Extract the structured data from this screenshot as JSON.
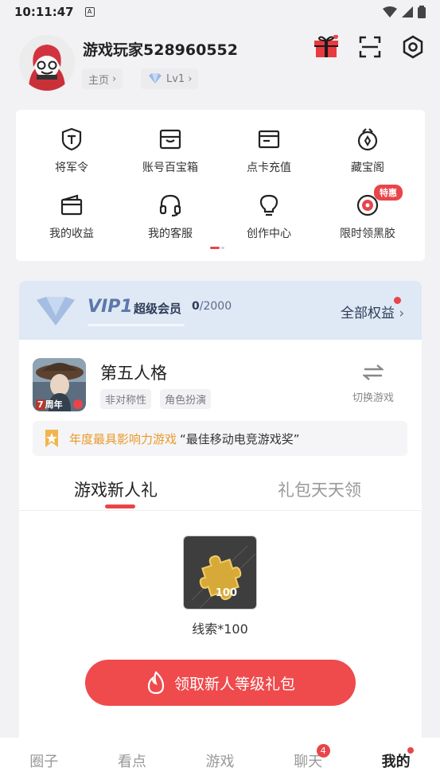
{
  "status": {
    "time": "10:11:47",
    "indicator": "A"
  },
  "profile": {
    "username": "游戏玩家528960552",
    "home_label": "主页",
    "level_label": "Lv1"
  },
  "quick_menu": [
    {
      "label": "将军令",
      "icon": "shield-t-icon"
    },
    {
      "label": "账号百宝箱",
      "icon": "treasure-box-icon"
    },
    {
      "label": "点卡充值",
      "icon": "card-icon"
    },
    {
      "label": "藏宝阁",
      "icon": "treasure-pavilion-icon"
    },
    {
      "label": "我的收益",
      "icon": "wallet-icon"
    },
    {
      "label": "我的客服",
      "icon": "headset-icon"
    },
    {
      "label": "创作中心",
      "icon": "bulb-icon"
    },
    {
      "label": "限时领黑胶",
      "icon": "vinyl-icon"
    }
  ],
  "special_badge": "特惠",
  "vip": {
    "title": "VIP1",
    "subtitle": "超级会员",
    "progress": "0",
    "total": "/2000",
    "all_rights": "全部权益",
    "progress_fraction": 0
  },
  "game": {
    "name": "第五人格",
    "tags": [
      "非对称性",
      "角色扮演"
    ],
    "switch_label": "切换游戏",
    "icon_caption": "周年"
  },
  "award": {
    "highlight": "年度最具影响力游戏",
    "text": "“最佳移动电竞游戏奖”"
  },
  "gift_tabs": [
    {
      "label": "游戏新人礼",
      "active": true
    },
    {
      "label": "礼包天天领",
      "active": false
    }
  ],
  "gift_item": {
    "name": "线索*100",
    "count": "100"
  },
  "claim_button": "领取新人等级礼包",
  "bottom_tabs": [
    {
      "label": "圈子",
      "active": false
    },
    {
      "label": "看点",
      "active": false
    },
    {
      "label": "游戏",
      "active": false
    },
    {
      "label": "聊天",
      "active": false,
      "badge": "4"
    },
    {
      "label": "我的",
      "active": true
    }
  ],
  "colors": {
    "accent": "#e8454b",
    "vip_bg": "#dfe8f5",
    "award_orange": "#e89a2a"
  }
}
